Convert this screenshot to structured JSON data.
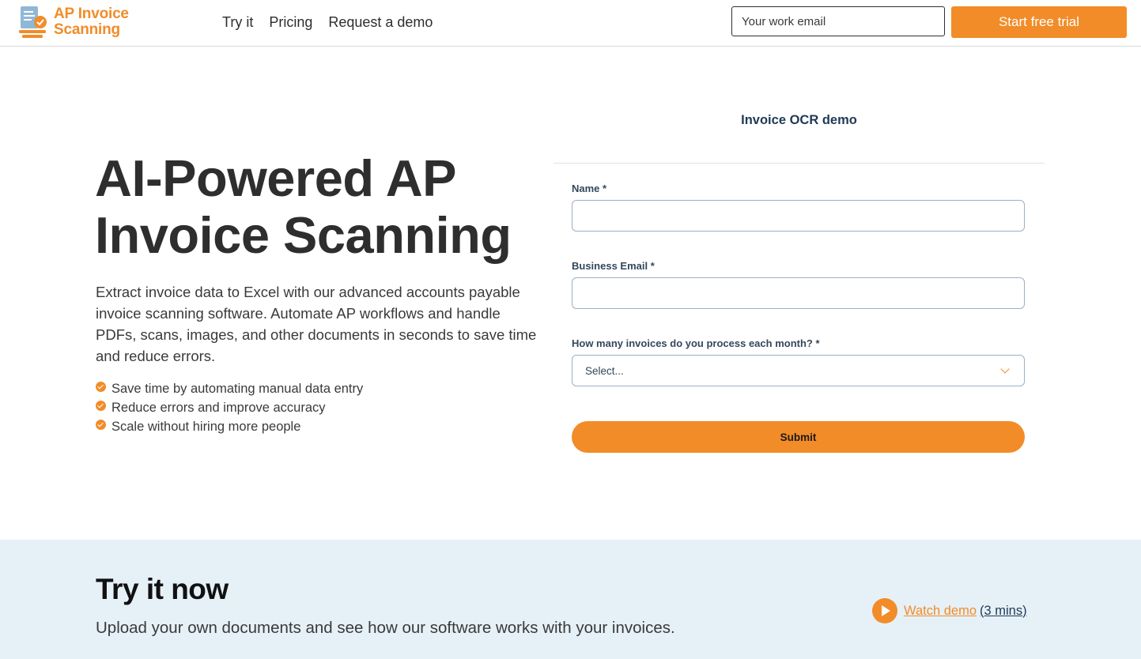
{
  "header": {
    "logo": {
      "line1": "AP Invoice",
      "line2": "Scanning",
      "icon": "invoice-check-icon"
    },
    "nav": [
      "Try it",
      "Pricing",
      "Request a demo"
    ],
    "email_placeholder": "Your work email",
    "trial_label": "Start free trial"
  },
  "hero": {
    "title_line1": "AI-Powered AP",
    "title_line2": "Invoice Scanning",
    "description": "Extract invoice data to Excel with our advanced accounts payable invoice scanning software. Automate AP workflows and handle PDFs, scans, images, and other documents in seconds to save time and reduce errors.",
    "bullets": [
      "Save time by automating manual data entry",
      "Reduce errors and improve accuracy",
      "Scale without hiring more people"
    ]
  },
  "form": {
    "title": "Invoice OCR demo",
    "name_label": "Name *",
    "email_label": "Business Email *",
    "invoices_label": "How many invoices do you process each month? *",
    "select_value": "Select...",
    "submit_label": "Submit"
  },
  "try_now": {
    "title": "Try it now",
    "subtitle": "Upload your own documents and see how our software works with your invoices.",
    "watch_label": "Watch demo",
    "watch_duration": "(3 mins)"
  },
  "colors": {
    "accent": "#f28c28",
    "band": "#e6f0f7",
    "heading": "#2e2e2e",
    "form_text": "#33475b"
  }
}
